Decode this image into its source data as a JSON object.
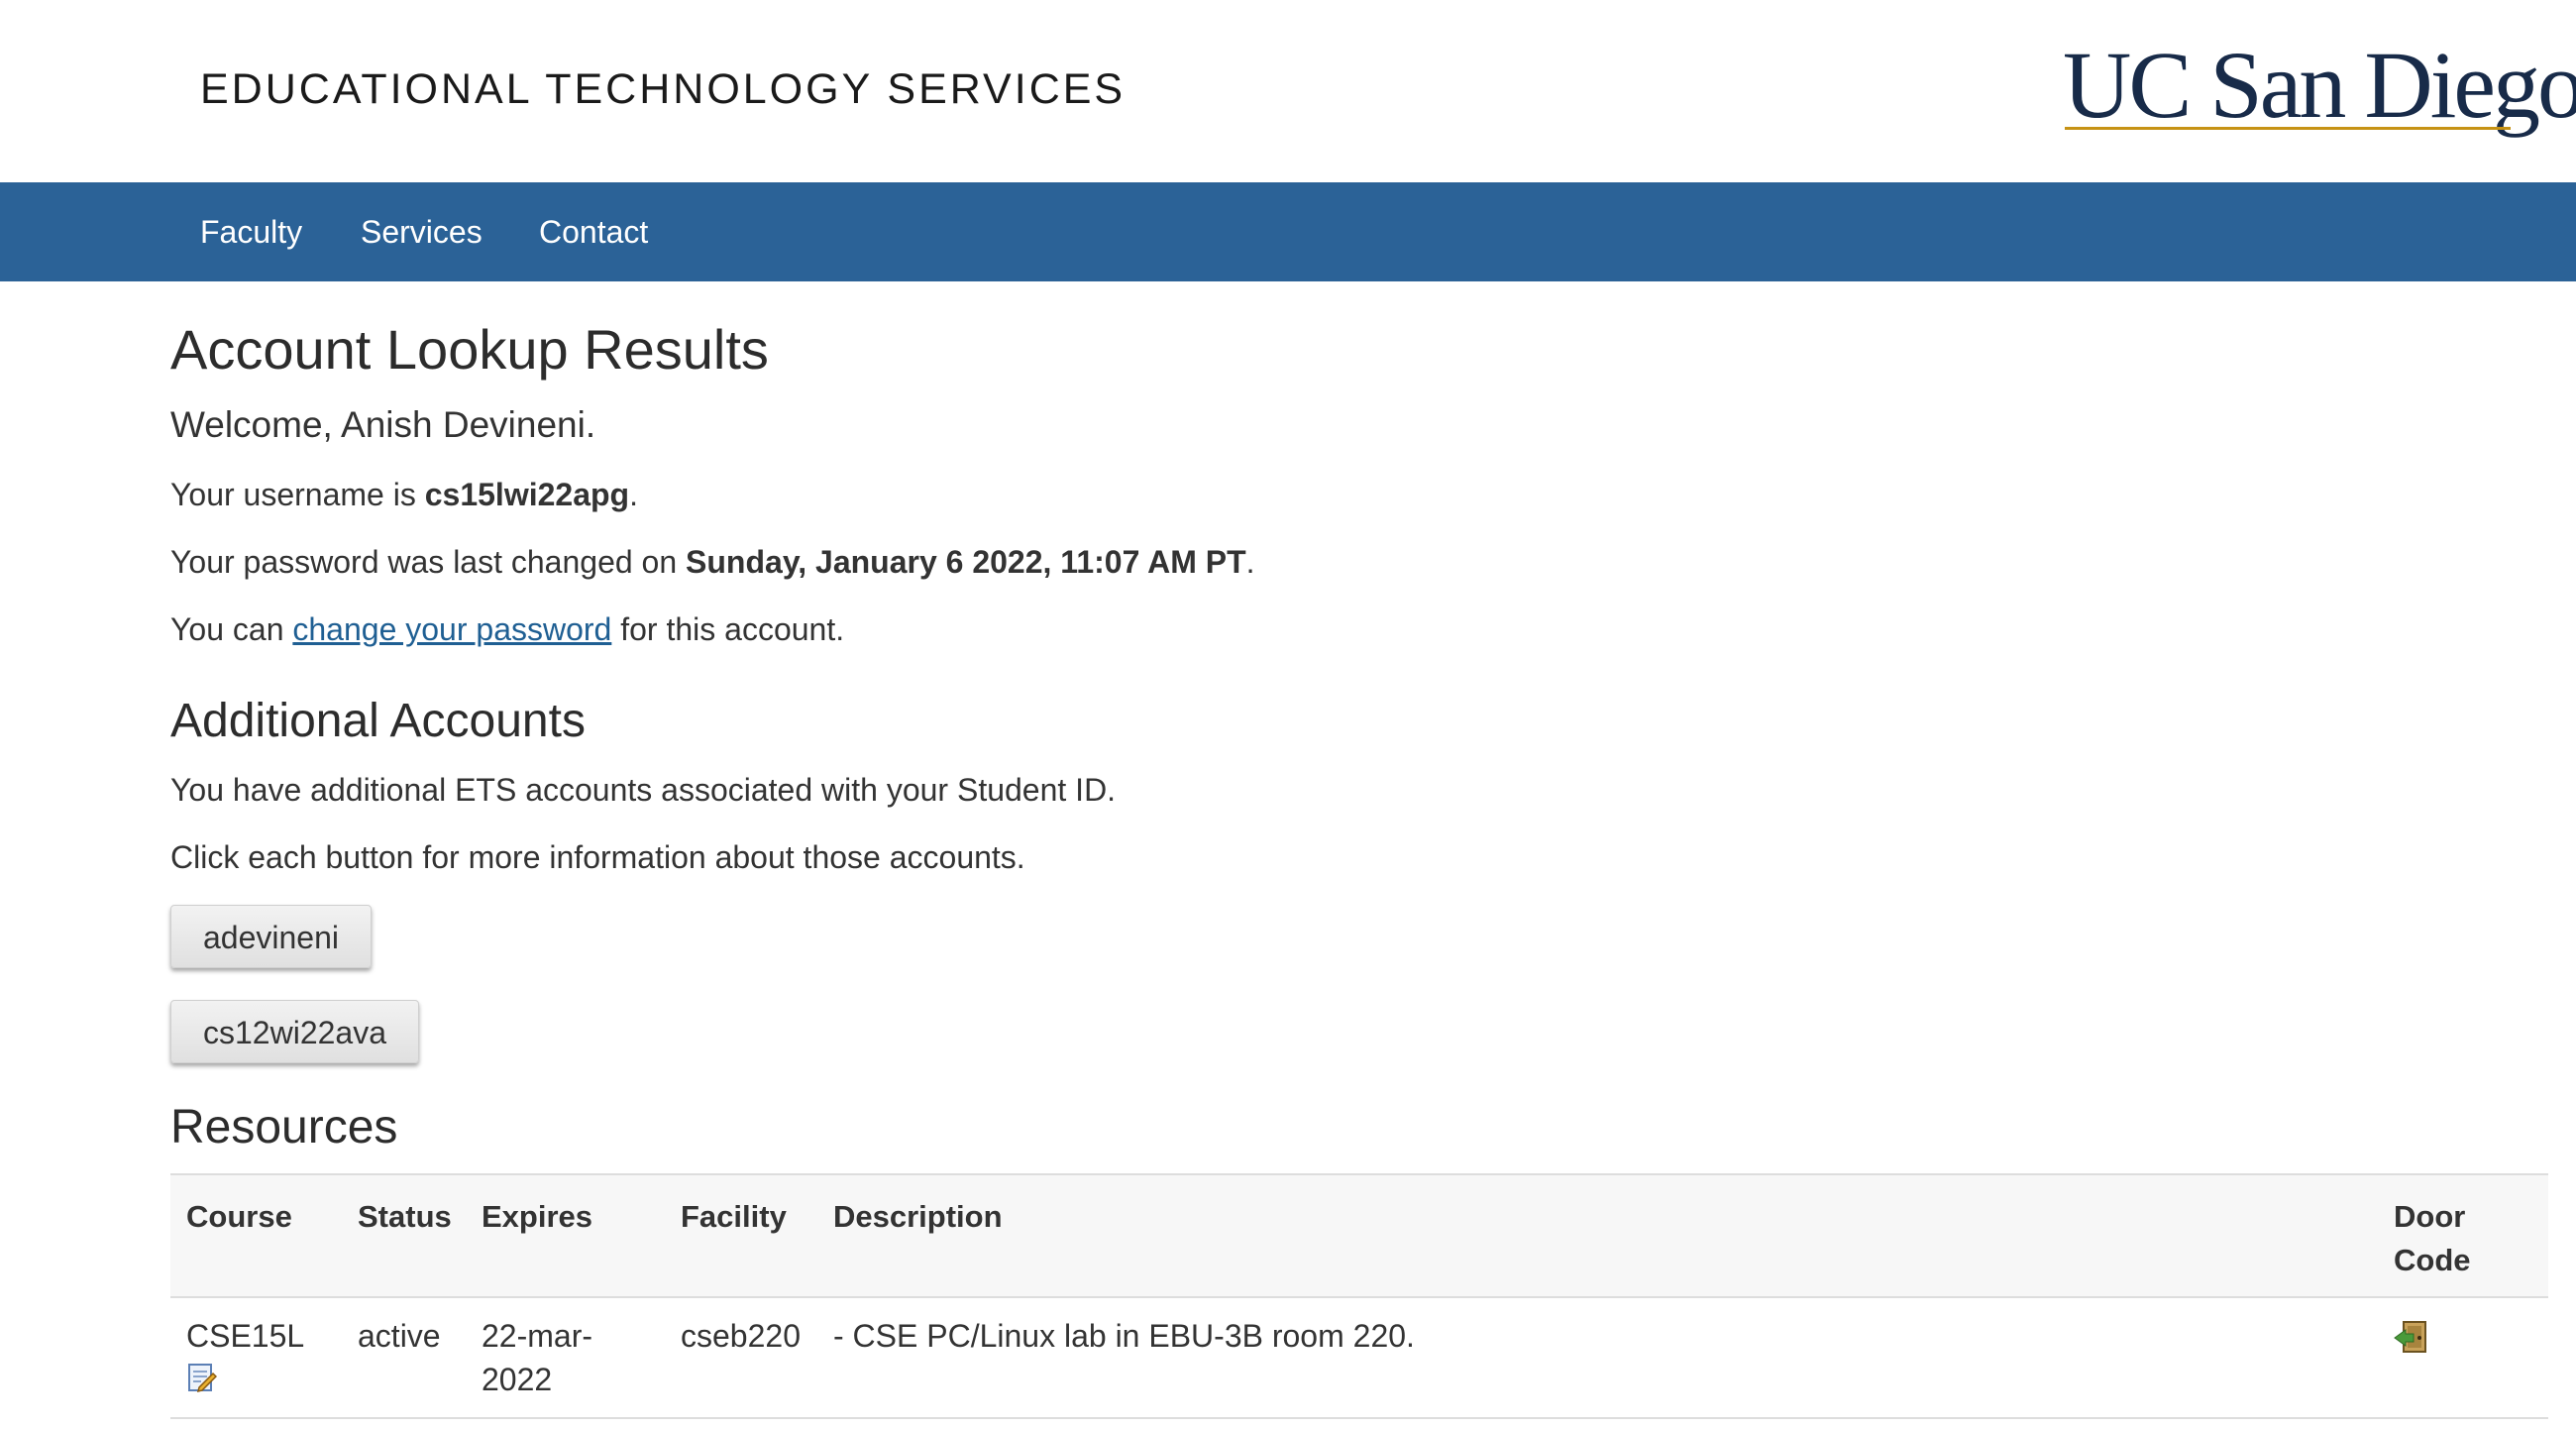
{
  "header": {
    "site_title": "EDUCATIONAL TECHNOLOGY SERVICES",
    "logo_text": "UC San Diego"
  },
  "nav": {
    "items": [
      {
        "label": "Faculty"
      },
      {
        "label": "Services"
      },
      {
        "label": "Contact"
      }
    ]
  },
  "main": {
    "title": "Account Lookup Results",
    "welcome": "Welcome, Anish Devineni.",
    "username_prefix": "Your username is ",
    "username": "cs15lwi22apg",
    "username_suffix": ".",
    "password_prefix": "Your password was last changed on ",
    "password_date": "Sunday, January 6 2022, 11:07 AM PT",
    "password_suffix": ".",
    "change_prefix": "You can ",
    "change_link": "change your password",
    "change_suffix": " for this account."
  },
  "additional": {
    "heading": "Additional Accounts",
    "line1": "You have additional ETS accounts associated with your Student ID.",
    "line2": "Click each button for more information about those accounts.",
    "accounts": [
      "adevineni",
      "cs12wi22ava"
    ]
  },
  "resources": {
    "heading": "Resources",
    "columns": [
      "Course",
      "Status",
      "Expires",
      "Facility",
      "Description",
      "Door Code"
    ],
    "rows": [
      {
        "course": "CSE15L",
        "status": "active",
        "expires": "22-mar-2022",
        "facility": "cseb220",
        "description": "- CSE PC/Linux lab in EBU-3B room 220."
      }
    ]
  },
  "colors": {
    "nav_bg": "#2b6297",
    "logo_navy": "#182b49",
    "logo_gold": "#c69214",
    "link": "#1f5f93"
  }
}
